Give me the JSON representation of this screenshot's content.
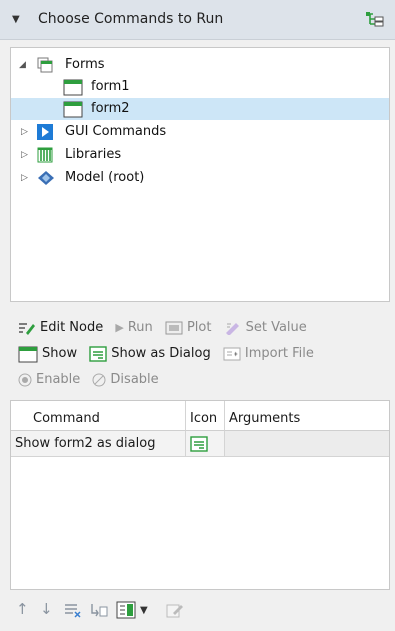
{
  "header": {
    "title": "Choose Commands to Run",
    "icon": "tree-structure-icon"
  },
  "tree": {
    "items": [
      {
        "label": "Forms",
        "icon": "forms-folder-icon",
        "expanded": true
      },
      {
        "label": "form1",
        "icon": "form-icon"
      },
      {
        "label": "form2",
        "icon": "form-icon",
        "selected": true
      },
      {
        "label": "GUI Commands",
        "icon": "gui-commands-icon",
        "expanded": false
      },
      {
        "label": "Libraries",
        "icon": "libraries-icon",
        "expanded": false
      },
      {
        "label": "Model (root)",
        "icon": "model-root-icon",
        "expanded": false
      }
    ]
  },
  "toolbar": {
    "edit_node": "Edit Node",
    "run": "Run",
    "plot": "Plot",
    "set_value": "Set Value",
    "show": "Show",
    "show_as_dialog": "Show as Dialog",
    "import_file": "Import File",
    "enable": "Enable",
    "disable": "Disable"
  },
  "table": {
    "headers": [
      "Command",
      "Icon",
      "Arguments"
    ],
    "rows": [
      {
        "command": "Show form2 as dialog",
        "icon": "dialog-icon",
        "arguments": ""
      }
    ]
  },
  "bottom_toolbar": {
    "buttons": [
      "move-up-icon",
      "move-down-icon",
      "delete-icon",
      "move-to-icon",
      "insert-icon",
      "dropdown-icon",
      "edit-icon"
    ]
  },
  "colors": {
    "selection": "#cde6f7",
    "header_bg": "#dde3ea",
    "form_icon_green": "#2e9e3e",
    "gui_blue": "#1e7bd6"
  }
}
